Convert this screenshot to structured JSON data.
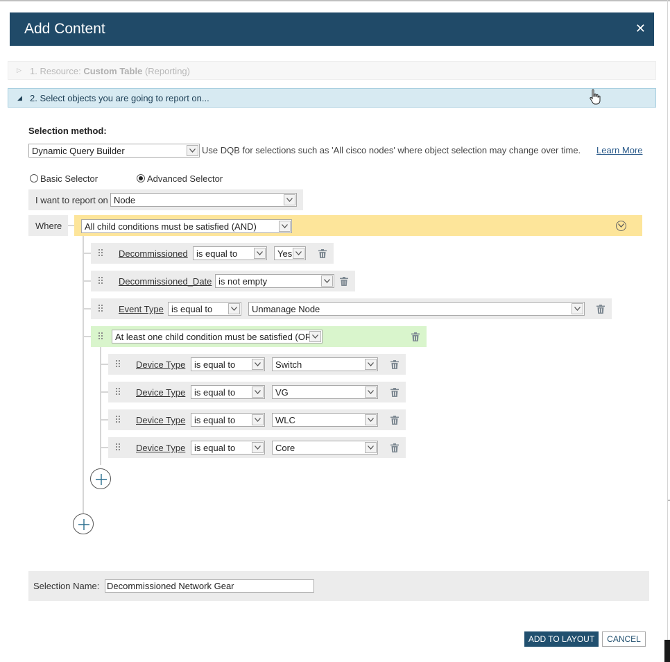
{
  "dialog": {
    "title": "Add Content",
    "close_icon": "✕"
  },
  "steps": [
    {
      "prefix": "1. Resource: ",
      "name": "Custom Table",
      "suffix": "(Reporting)"
    },
    {
      "label": "2. Select objects you are going to report on..."
    }
  ],
  "selection": {
    "method_label": "Selection method:",
    "method_value": "Dynamic Query Builder",
    "method_hint": "Use DQB for selections such as 'All cisco nodes' where object selection may change over time.",
    "learn_more": "Learn More",
    "radio_basic": "Basic Selector",
    "radio_advanced": "Advanced Selector",
    "selected_radio": "Advanced Selector",
    "report_on_label": "I want to report on",
    "report_on_value": "Node",
    "where_label": "Where"
  },
  "query": {
    "root_operator": "All child conditions must be satisfied (AND)",
    "conditions": [
      {
        "field": "Decommissioned",
        "operator": "is equal to",
        "value": "Yes"
      },
      {
        "field": "Decommissioned_Date",
        "operator": "is not empty"
      },
      {
        "field": "Event Type",
        "operator": "is equal to",
        "value": "Unmanage Node"
      }
    ],
    "group": {
      "operator": "At least one child condition must be satisfied (OR)",
      "conditions": [
        {
          "field": "Device Type",
          "operator": "is equal to",
          "value": "Switch"
        },
        {
          "field": "Device Type",
          "operator": "is equal to",
          "value": "VG"
        },
        {
          "field": "Device Type",
          "operator": "is equal to",
          "value": "WLC"
        },
        {
          "field": "Device Type",
          "operator": "is equal to",
          "value": "Core"
        }
      ]
    }
  },
  "footer": {
    "selection_name_label": "Selection Name:",
    "selection_name_value": "Decommissioned Network Gear",
    "add_button": "ADD TO LAYOUT",
    "cancel_button": "CANCEL"
  },
  "colors": {
    "header_bg": "#204a68",
    "and_bar": "#fde59a",
    "or_bar": "#d9f5cc",
    "active_step_bg": "#d7eaf2",
    "primary_button": "#21506f",
    "link": "#2a5a8a"
  },
  "icons": [
    "close-icon",
    "expand-triangle-icon",
    "collapse-triangle-icon",
    "dropdown-arrow-icon",
    "drag-handle-icon",
    "trash-icon",
    "add-condition-icon",
    "collapse-circle-icon",
    "hand-cursor-icon"
  ]
}
